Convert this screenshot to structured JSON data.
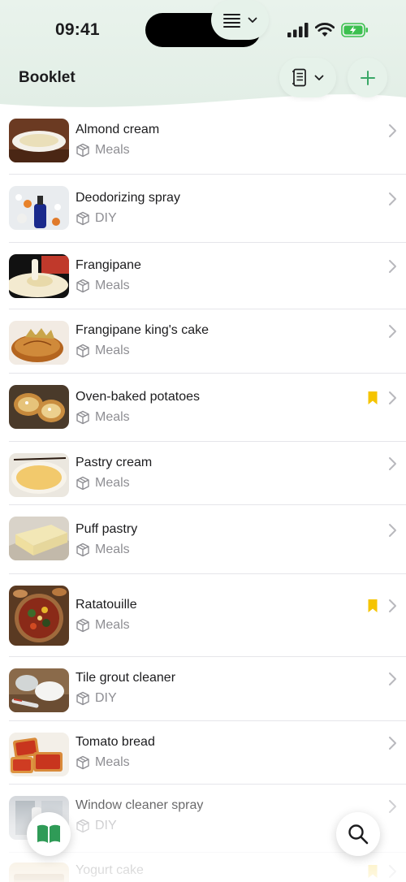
{
  "status": {
    "time": "09:41"
  },
  "header": {
    "title": "Booklet"
  },
  "colors": {
    "accent": "#3aa867",
    "bookmark": "#f5c400",
    "secondary": "#8e8e93",
    "header_bg": "#e6f2ea"
  },
  "items": [
    {
      "title": "Almond cream",
      "category": "Meals",
      "bookmarked": false
    },
    {
      "title": "Deodorizing spray",
      "category": "DIY",
      "bookmarked": false
    },
    {
      "title": "Frangipane",
      "category": "Meals",
      "bookmarked": false
    },
    {
      "title": "Frangipane king's cake",
      "category": "Meals",
      "bookmarked": false
    },
    {
      "title": "Oven-baked potatoes",
      "category": "Meals",
      "bookmarked": true
    },
    {
      "title": "Pastry cream",
      "category": "Meals",
      "bookmarked": false
    },
    {
      "title": "Puff pastry",
      "category": "Meals",
      "bookmarked": false
    },
    {
      "title": "Ratatouille",
      "category": "Meals",
      "bookmarked": true
    },
    {
      "title": "Tile grout cleaner",
      "category": "DIY",
      "bookmarked": false
    },
    {
      "title": "Tomato bread",
      "category": "Meals",
      "bookmarked": false
    },
    {
      "title": "Window cleaner spray",
      "category": "DIY",
      "bookmarked": false
    },
    {
      "title": "Yogurt cake",
      "category": "",
      "bookmarked": true
    }
  ],
  "icons": {
    "list_view": "list-icon",
    "booklet_select": "notebook-icon",
    "add": "plus-icon",
    "category": "box-icon",
    "bookmark": "bookmark-icon",
    "booklet_tab": "open-book-icon",
    "search": "search-icon"
  }
}
